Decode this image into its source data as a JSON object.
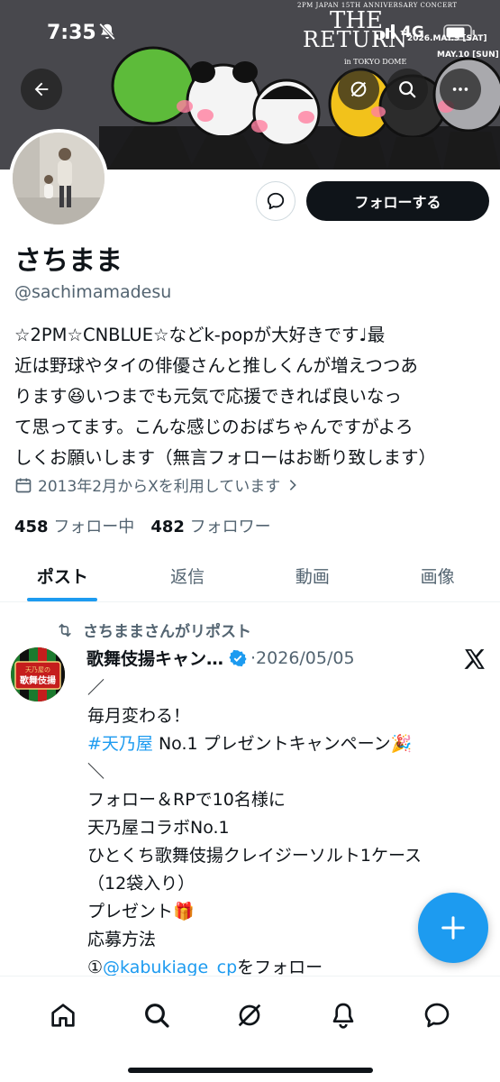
{
  "status_bar": {
    "time": "7:35",
    "network": "4G"
  },
  "banner": {
    "concert_line": "2PM JAPAN 15TH ANNIVERSARY CONCERT",
    "title_line1": "THE",
    "title_line2": "RETURN",
    "venue": "in TOKYO DOME",
    "date1": "2026.MAY.9 [SAT]",
    "date2": "MAY.10 [SUN]"
  },
  "profile": {
    "follow_label": "フォローする",
    "name": "さちまま",
    "handle": "@sachimamadesu",
    "bio_lines": [
      "☆2PM☆CNBLUE☆などk-popが大好きです♩最",
      "近は野球やタイの俳優さんと推しくんが増えつつあ",
      "ります😆いつまでも元気で応援できれば良いなっ",
      "て思ってます。こんな感じのおばちゃんですがよろ",
      "しくお願いします（無言フォローはお断り致します）"
    ],
    "joined": "2013年2月からXを利用しています",
    "following_count": "458",
    "following_label": "フォロー中",
    "followers_count": "482",
    "followers_label": "フォロワー"
  },
  "tabs": [
    "ポスト",
    "返信",
    "動画",
    "画像"
  ],
  "post": {
    "repost_label": "さちままさんがリポスト",
    "author": "歌舞伎揚キャン…",
    "date": "·2026/05/05",
    "avatar_text_top": "天乃屋の",
    "avatar_text_bottom": "歌舞伎揚",
    "line1": "／",
    "line2": "毎月変わる！",
    "hashtag": "#天乃屋",
    "line3_rest": " No.1 プレゼントキャンペーン🎉",
    "line4": "＼",
    "line5": "フォロー＆RPで10名様に",
    "line6": "天乃屋コラボNo.1",
    "line7": "ひとくち歌舞伎揚クレイジーソルト1ケース",
    "line8": "（12袋入り）",
    "line9": "プレゼント🎁",
    "line10": "応募方法",
    "line11_prefix": "①",
    "mention": "@kabukiage_cp",
    "line11_suffix": "をフォロー"
  },
  "colors": {
    "accent": "#1d9bf0",
    "text": "#0f1419",
    "muted": "#536471"
  }
}
